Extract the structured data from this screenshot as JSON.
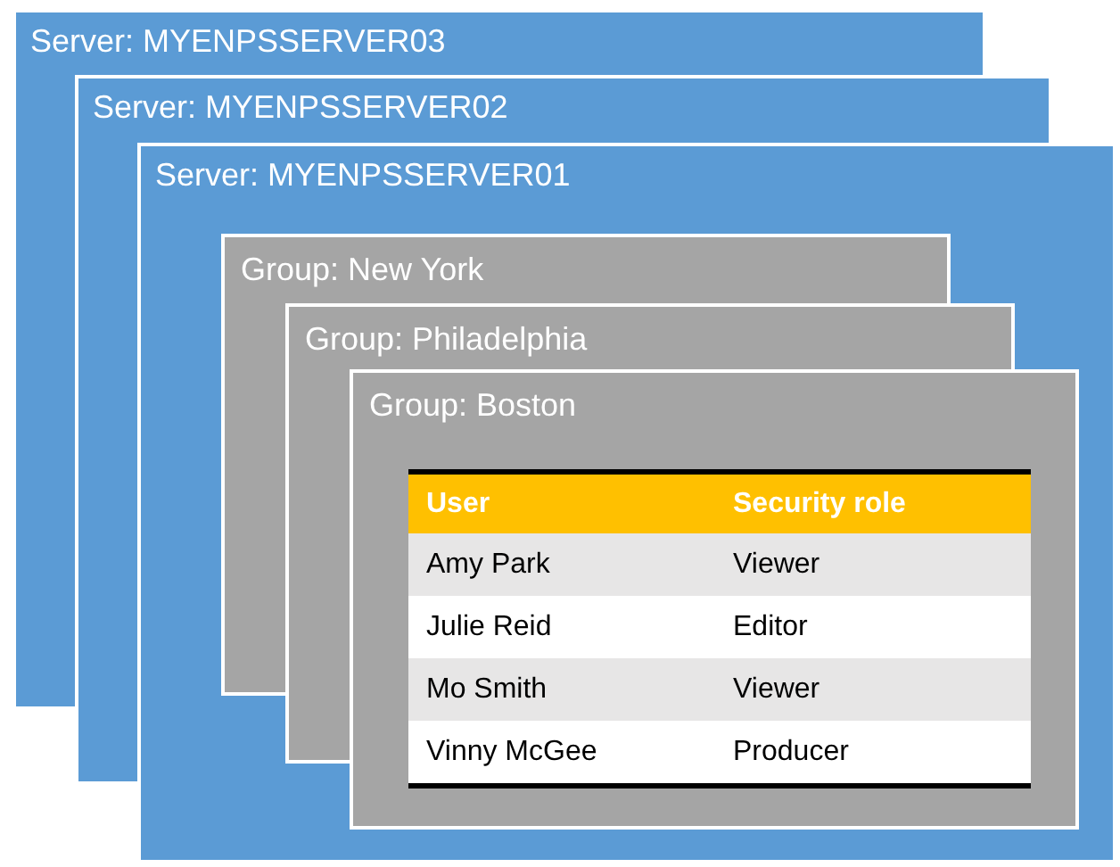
{
  "servers": [
    {
      "title": "Server: MYENPSSERVER03"
    },
    {
      "title": "Server: MYENPSSERVER02"
    },
    {
      "title": "Server: MYENPSSERVER01"
    }
  ],
  "groups": [
    {
      "title": "Group: New York"
    },
    {
      "title": "Group: Philadelphia"
    },
    {
      "title": "Group: Boston"
    }
  ],
  "table": {
    "columns": [
      "User",
      "Security role"
    ],
    "rows": [
      [
        "Amy Park",
        "Viewer"
      ],
      [
        "Julie Reid",
        "Editor"
      ],
      [
        "Mo Smith",
        "Viewer"
      ],
      [
        "Vinny McGee",
        "Producer"
      ]
    ]
  }
}
